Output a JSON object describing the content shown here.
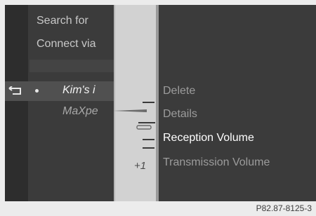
{
  "menu": {
    "search_label": "Search for",
    "connect_label": "Connect via"
  },
  "contacts": [
    {
      "name": "Kim's i",
      "selected": true
    },
    {
      "name": "MaXpe",
      "selected": false
    }
  ],
  "slider": {
    "level_text": "+1"
  },
  "options": [
    {
      "label": "Delete",
      "selected": false
    },
    {
      "label": "Details",
      "selected": false
    },
    {
      "label": "Reception Volume",
      "selected": true
    },
    {
      "label": "Transmission Volume",
      "selected": false
    }
  ],
  "footer": {
    "ref": "P82.87-8125-3"
  },
  "icons": {
    "back": "back-arrow-icon",
    "bullet": "bullet-icon"
  },
  "colors": {
    "screen_bg": "#3b3b3b",
    "panel_bg": "#d2d2d2",
    "selected_text": "#ffffff",
    "dim_text": "#9c9c9c"
  }
}
